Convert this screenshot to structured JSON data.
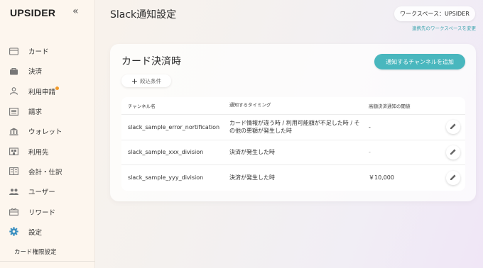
{
  "app": {
    "logo": "UPSIDER",
    "collapse_icon": "«"
  },
  "sidebar": {
    "items": [
      {
        "label": "カード",
        "icon": "card-icon"
      },
      {
        "label": "決済",
        "icon": "bag-icon"
      },
      {
        "label": "利用申請",
        "icon": "person-icon",
        "badge_dot": true
      },
      {
        "label": "請求",
        "icon": "list-icon"
      },
      {
        "label": "ウォレット",
        "icon": "bank-icon"
      },
      {
        "label": "利用先",
        "icon": "store-icon"
      },
      {
        "label": "会計・仕訳",
        "icon": "ledger-icon"
      },
      {
        "label": "ユーザー",
        "icon": "users-icon"
      },
      {
        "label": "リワード",
        "icon": "gift-icon"
      },
      {
        "label": "設定",
        "icon": "gear-icon",
        "active": true
      }
    ],
    "sub_item": "カード権限設定"
  },
  "header": {
    "title": "Slack通知設定",
    "workspace_label": "ワークスペース：UPSIDER",
    "workspace_change": "連携先のワークスペースを変更"
  },
  "card": {
    "title": "カード決済時",
    "add_button": "通知するチャンネルを追加",
    "filter_button": "絞込条件"
  },
  "table": {
    "columns": [
      "チャンネル名",
      "通知するタイミング",
      "高額決済通知の閾値",
      ""
    ],
    "rows": [
      {
        "channel": "slack_sample_error_nortification",
        "timing": "カード情報が違う時 / 利用可能額が不足した時 / その他の悪額が発生した時",
        "threshold": "-"
      },
      {
        "channel": "slack_sample_xxx_division",
        "timing": "決済が発生した時",
        "threshold": "-"
      },
      {
        "channel": "slack_sample_yyy_division",
        "timing": "決済が発生した時",
        "threshold": "￥10,000"
      }
    ]
  },
  "colors": {
    "accent": "#49b7be",
    "active_icon": "#3a8fc0",
    "badge": "#f39a28",
    "link": "#3aa3ad"
  }
}
